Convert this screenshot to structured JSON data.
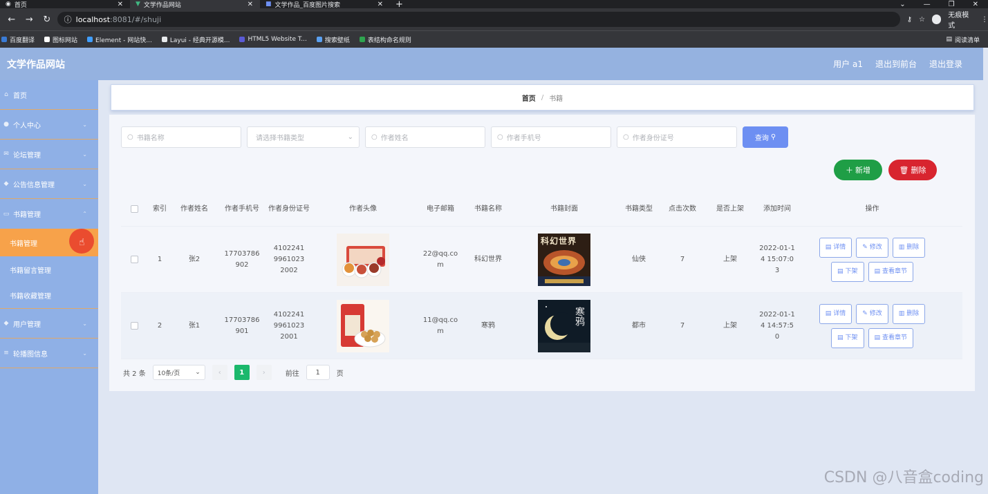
{
  "browser": {
    "tabs": [
      {
        "label": "首页",
        "active": false
      },
      {
        "label": "文学作品网站",
        "active": true
      },
      {
        "label": "文学作品_百度图片搜索",
        "active": false
      }
    ],
    "url_host": "localhost",
    "url_path": ":8081/#/shuji",
    "incognito_label": "无痕模式",
    "bookmarks": [
      "百度翻译",
      "图标网站",
      "Element - 网站快...",
      "Layui - 经典开源模...",
      "HTML5 Website T...",
      "搜索壁纸",
      "表结构命名规则"
    ],
    "reading_list": "阅读清单"
  },
  "header": {
    "title": "文学作品网站",
    "user": "用户 a1",
    "back_admin": "退出到前台",
    "logout": "退出登录"
  },
  "sidebar": {
    "items": [
      {
        "label": "首页"
      },
      {
        "label": "个人中心"
      },
      {
        "label": "论坛管理"
      },
      {
        "label": "公告信息管理"
      },
      {
        "label": "书籍管理"
      }
    ],
    "sub_items": [
      {
        "label": "书籍管理",
        "active": true
      },
      {
        "label": "书籍留言管理",
        "active": false
      },
      {
        "label": "书籍收藏管理",
        "active": false
      }
    ],
    "items_after": [
      {
        "label": "用户管理"
      },
      {
        "label": "轮播图信息"
      }
    ]
  },
  "breadcrumb": {
    "home": "首页",
    "sep": "/",
    "current": "书籍"
  },
  "search": {
    "book_name": "书籍名称",
    "book_type": "请选择书籍类型",
    "author_name": "作者姓名",
    "author_phone": "作者手机号",
    "author_id": "作者身份证号",
    "query_label": "查询"
  },
  "actions": {
    "add": "新增",
    "delete": "删除"
  },
  "table": {
    "headers": [
      "索引",
      "作者姓名",
      "作者手机号",
      "作者身份证号",
      "作者头像",
      "电子邮箱",
      "书籍名称",
      "书籍封面",
      "书籍类型",
      "点击次数",
      "是否上架",
      "添加时间",
      "操作"
    ],
    "rows": [
      {
        "index": "1",
        "author": "张2",
        "phone": "17703786902",
        "idcard": "410224199610232002",
        "email": "22@qq.com",
        "book": "科幻世界",
        "cover_text": "科幻世界",
        "type": "仙侠",
        "clicks": "7",
        "onshelf": "上架",
        "time": "2022-01-14 15:07:03"
      },
      {
        "index": "2",
        "author": "张1",
        "phone": "17703786901",
        "idcard": "410224199610232001",
        "email": "11@qq.com",
        "book": "寒鸦",
        "cover_text": "寒鸦",
        "type": "都市",
        "clicks": "7",
        "onshelf": "上架",
        "time": "2022-01-14 14:57:50"
      }
    ],
    "ops": {
      "detail": "详情",
      "edit": "修改",
      "delete": "删除",
      "offshelf": "下架",
      "chapters": "查看章节"
    }
  },
  "pagination": {
    "total": "共 2 条",
    "page_size": "10条/页",
    "current": "1",
    "goto_prefix": "前往",
    "goto_value": "1",
    "goto_suffix": "页"
  },
  "watermark": "CSDN @八音盒coding",
  "colors": {
    "header": "#95b2e0",
    "sidebar": "#8fb0e6",
    "active": "#f7a24a",
    "primary": "#6d8ff2",
    "add": "#1f9e46",
    "danger": "#d8252f",
    "page_active": "#1bb86c"
  }
}
